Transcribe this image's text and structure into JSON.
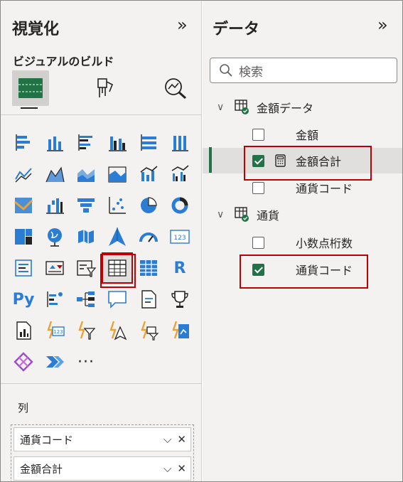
{
  "left_pane": {
    "title": "視覚化",
    "collapse_glyph": "»",
    "subtitle": "ビジュアルのビルド",
    "python_label": "Py",
    "r_label": "R",
    "card_number": "123",
    "more_label": "···",
    "columns_label": "列",
    "wells": [
      {
        "label": "通貨コード"
      },
      {
        "label": "金額合計"
      }
    ]
  },
  "right_pane": {
    "title": "データ",
    "collapse_glyph": "»",
    "search_placeholder": "検索",
    "tables": [
      {
        "name": "金額データ",
        "fields": [
          {
            "name": "金額",
            "checked": false
          },
          {
            "name": "金額合計",
            "checked": true,
            "icon": "calculator-icon"
          },
          {
            "name": "通貨コード",
            "checked": false
          }
        ]
      },
      {
        "name": "通貨",
        "fields": [
          {
            "name": "小数点桁数",
            "checked": false
          },
          {
            "name": "通貨コード",
            "checked": true
          }
        ]
      }
    ]
  },
  "colors": {
    "accent_green": "#217346",
    "highlight_red": "#c00000",
    "visual_blue": "#2b7cd3"
  }
}
